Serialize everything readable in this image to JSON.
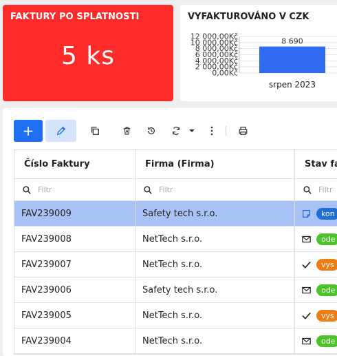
{
  "overdue": {
    "title": "FAKTURY PO SPLATNOSTI",
    "value": "5 ks",
    "bg": "#ff2b2b"
  },
  "invoiced": {
    "title": "VYFAKTUROVÁNO V CZK"
  },
  "chart_data": {
    "type": "bar",
    "categories": [
      "srpen 2023"
    ],
    "values": [
      8690
    ],
    "data_labels": [
      "8 690"
    ],
    "yticks": [
      "0,00Kč",
      "2 000,00Kč",
      "4 000,00Kč",
      "6 000,00Kč",
      "8 000,00Kč",
      "10 000,00Kč",
      "12 000,00Kč"
    ],
    "ylim": [
      0,
      12000
    ],
    "grid": true,
    "bar_color": "#2f6bf0"
  },
  "toolbar": {
    "add_label": "+",
    "icons": [
      "pencil-icon",
      "copy-icon",
      "trash-icon",
      "history-icon",
      "refresh-icon",
      "caret-down-icon",
      "more-vertical-icon",
      "print-icon"
    ]
  },
  "grid": {
    "columns": [
      "Číslo Faktury",
      "Firma (Firma)",
      "Stav fak"
    ],
    "filter_placeholder": "Filtr",
    "filter_partial": "Filtr",
    "rows": [
      {
        "number": "FAV239009",
        "company": "Safety tech s.r.o.",
        "status_icon": "note-icon",
        "status": "kon",
        "status_color": "blue",
        "selected": true
      },
      {
        "number": "FAV239008",
        "company": "NetTech s.r.o.",
        "status_icon": "envelope-icon",
        "status": "ode",
        "status_color": "green",
        "selected": false
      },
      {
        "number": "FAV239007",
        "company": "NetTech s.r.o.",
        "status_icon": "check-icon",
        "status": "vys",
        "status_color": "orange",
        "selected": false
      },
      {
        "number": "FAV239006",
        "company": "Safety tech s.r.o.",
        "status_icon": "envelope-icon",
        "status": "ode",
        "status_color": "green",
        "selected": false
      },
      {
        "number": "FAV239005",
        "company": "NetTech s.r.o.",
        "status_icon": "check-icon",
        "status": "vys",
        "status_color": "orange",
        "selected": false
      },
      {
        "number": "FAV239004",
        "company": "NetTech s.r.o.",
        "status_icon": "envelope-icon",
        "status": "ode",
        "status_color": "green",
        "selected": false
      }
    ]
  }
}
